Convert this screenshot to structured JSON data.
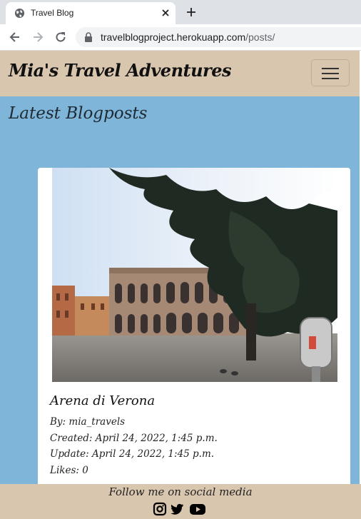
{
  "browser": {
    "tab_title": "Travel Blog",
    "url_host": "travelblogproject.herokuapp.com",
    "url_path": "/posts/",
    "icons": [
      "globe-icon",
      "close-icon",
      "plus-icon",
      "back-arrow-icon",
      "forward-arrow-icon",
      "reload-icon",
      "lock-icon"
    ]
  },
  "navbar": {
    "brand": "Mia's Travel Adventures",
    "toggler_icon": "hamburger-icon"
  },
  "main": {
    "heading": "Latest Blogposts",
    "post": {
      "title": "Arena di Verona",
      "author": "By: mia_travels",
      "created": "Created: April 24, 2022, 1:45 p.m.",
      "updated": "Update: April 24, 2022, 1:45 p.m.",
      "likes": "Likes: 0"
    }
  },
  "footer": {
    "text": "Follow me on social media",
    "icons": [
      "instagram-icon",
      "twitter-icon",
      "youtube-icon"
    ]
  },
  "colors": {
    "page_bg": "#7fb5d8",
    "nav_bg": "#d9c6af",
    "card_bg": "#ffffff"
  }
}
